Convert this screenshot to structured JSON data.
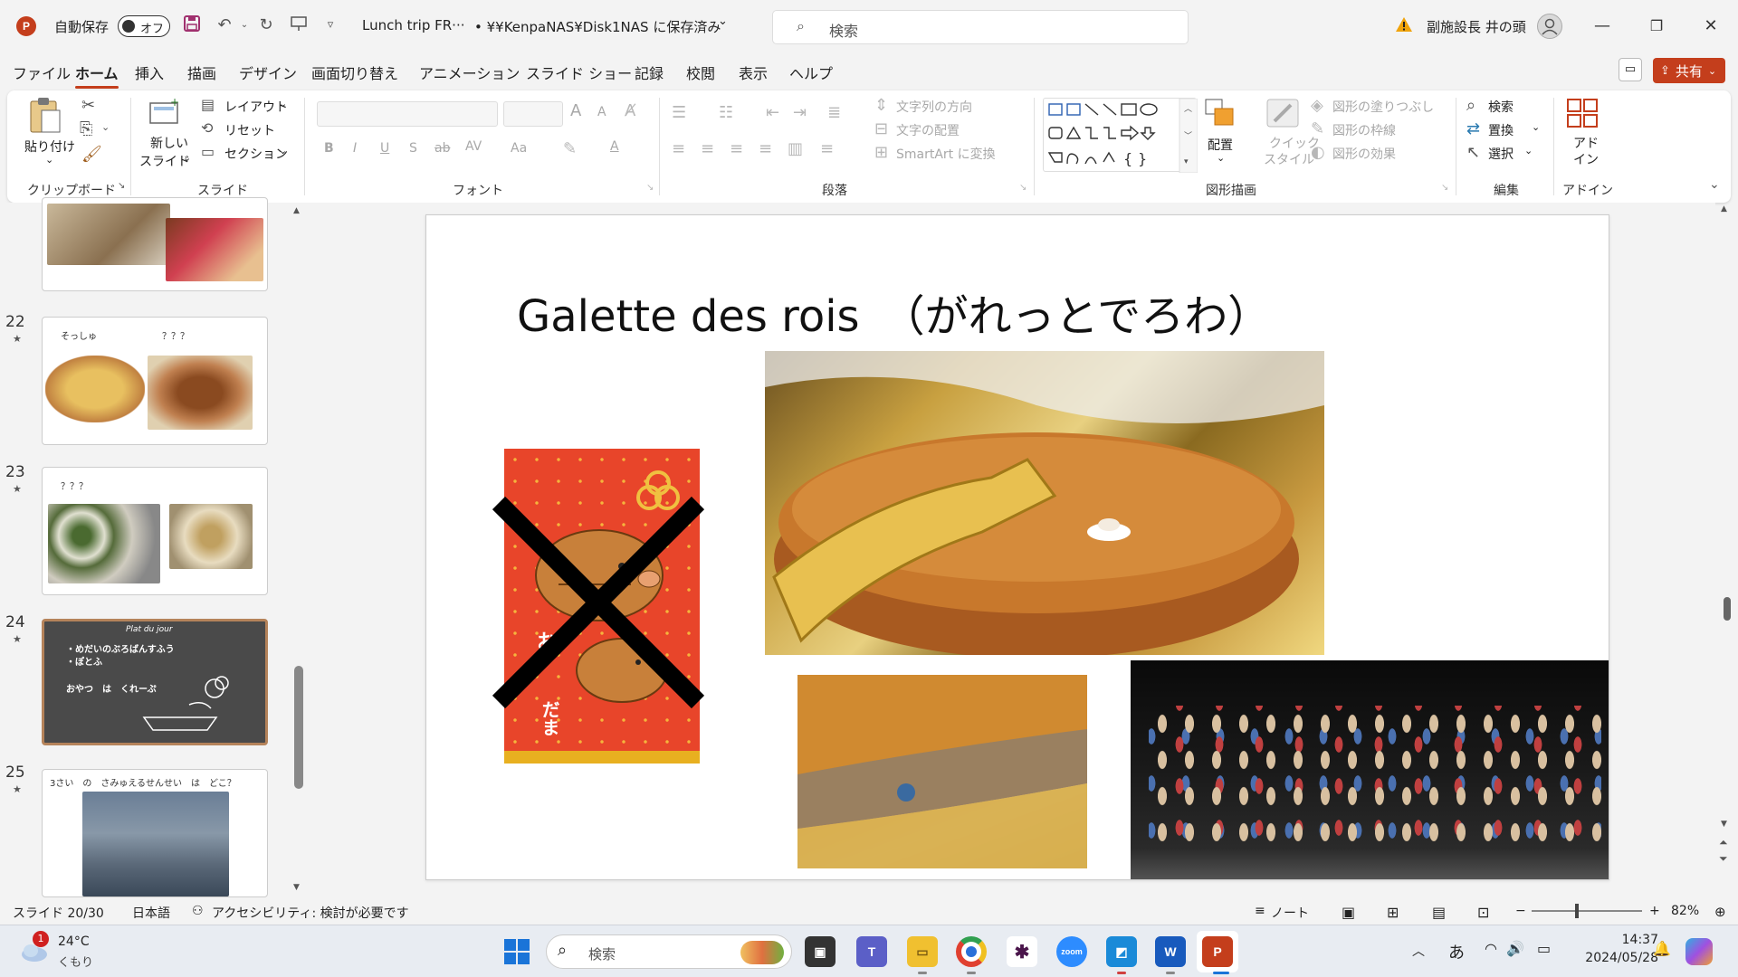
{
  "titlebar": {
    "autosave_label": "自動保存",
    "autosave_state": "オフ",
    "file_title": "Lunch trip FR···",
    "save_status": "• ¥¥KenpaNAS¥Disk1NAS に保存済み",
    "search_placeholder": "検索",
    "user_name": "副施設長 井の頭"
  },
  "menu": {
    "tabs": [
      "ファイル",
      "ホーム",
      "挿入",
      "描画",
      "デザイン",
      "画面切り替え",
      "アニメーション",
      "スライド ショー",
      "記録",
      "校閲",
      "表示",
      "ヘルプ"
    ],
    "share_label": "共有"
  },
  "ribbon": {
    "clipboard": {
      "paste": "貼り付け",
      "label": "クリップボード"
    },
    "slides": {
      "new_slide_1": "新しい",
      "new_slide_2": "スライド",
      "layout": "レイアウト",
      "reset": "リセット",
      "section": "セクション",
      "label": "スライド"
    },
    "font": {
      "label": "フォント",
      "bold": "B",
      "italic": "I",
      "underline": "U",
      "shadow": "S",
      "strike": "ab",
      "spacing": "AV",
      "case": "Aa",
      "grow": "A",
      "shrink": "A",
      "color": "A"
    },
    "paragraph": {
      "label": "段落",
      "text_direction": "文字列の方向",
      "align_text": "文字の配置",
      "smartart": "SmartArt に変換"
    },
    "drawing": {
      "label": "図形描画",
      "arrange": "配置",
      "quick_styles_1": "クイック",
      "quick_styles_2": "スタイル",
      "fill": "図形の塗りつぶし",
      "outline": "図形の枠線",
      "effects": "図形の効果"
    },
    "editing": {
      "label": "編集",
      "find": "検索",
      "replace": "置換",
      "select": "選択"
    },
    "addins": {
      "label": "アドイン",
      "button_1": "アド",
      "button_2": "イン"
    }
  },
  "thumbnails": [
    {
      "number": "22",
      "text_left": "そっしゅ",
      "text_right": "？？？"
    },
    {
      "number": "23",
      "text_left": "？？？"
    },
    {
      "number": "24",
      "heading": "Plat du jour",
      "line1": "・めだいのぶろばんすふう",
      "line2": "・ぽとふ",
      "line3": "おやつ　は　くれーぷ"
    },
    {
      "number": "25",
      "text": "3さい　の　さみゅえるせんせい　は　どこ？"
    }
  ],
  "slide": {
    "title": "Galette des rois　（がれっとでろわ）",
    "envelope_text_1": "お",
    "envelope_text_2": "だま"
  },
  "statusbar": {
    "slide_pos": "スライド 20/30",
    "language": "日本語",
    "accessibility": "アクセシビリティ: 検討が必要です",
    "notes": "ノート",
    "zoom": "82%"
  },
  "taskbar": {
    "weather_temp": "24°C",
    "weather_desc": "くもり",
    "weather_badge": "1",
    "search_placeholder": "検索",
    "ime": "あ",
    "time": "14:37",
    "date": "2024/05/28"
  },
  "colors": {
    "accent": "#c43e1c",
    "selected_thumb_border": "#b5835a",
    "envelope_red": "#e8452a"
  }
}
